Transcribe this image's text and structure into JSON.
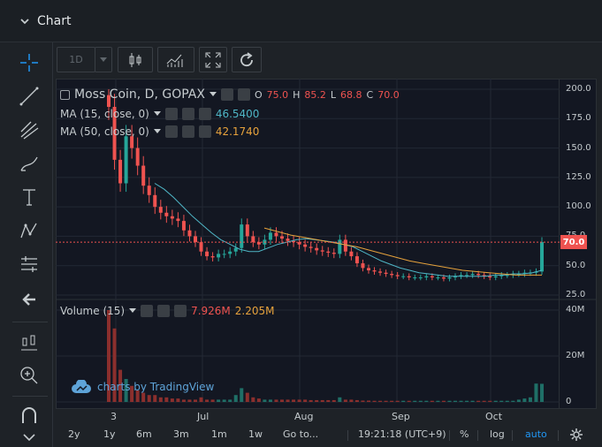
{
  "panel": {
    "title": "Chart"
  },
  "toolbar": {
    "interval": "1D"
  },
  "legend": {
    "symbol": "Moss Coin, D, GOPAX",
    "ohlc": [
      {
        "k": "O",
        "v": "75.0"
      },
      {
        "k": "H",
        "v": "85.2"
      },
      {
        "k": "L",
        "v": "68.8"
      },
      {
        "k": "C",
        "v": "70.0"
      }
    ],
    "ma15": {
      "label": "MA (15, close, 0)",
      "value": "46.5400",
      "color": "#4fb6c6"
    },
    "ma50": {
      "label": "MA (50, close, 0)",
      "value": "42.1740",
      "color": "#e6a23c"
    },
    "volume": {
      "label": "Volume (15)",
      "value1": "7.926M",
      "value2": "2.205M"
    }
  },
  "last_price": "70.0",
  "watermark": "charts by TradingView",
  "footer": {
    "ranges": [
      "2y",
      "1y",
      "6m",
      "3m",
      "1m",
      "1w",
      "Go to..."
    ],
    "time": "19:21:18 (UTC+9)",
    "percent": "%",
    "log": "log",
    "auto": "auto"
  },
  "colors": {
    "up": "#26a69a",
    "down": "#ef5350",
    "ma15": "#4fb6c6",
    "ma50": "#e6a23c",
    "accent": "#2196f3"
  },
  "chart_data": {
    "type": "candlestick",
    "title": "Moss Coin, D, GOPAX",
    "price_axis": {
      "ticks": [
        "200.0",
        "175.0",
        "150.0",
        "125.0",
        "100.0",
        "75.0",
        "50.0",
        "25.0"
      ],
      "ylim": [
        25,
        200
      ]
    },
    "volume_axis": {
      "ticks": [
        "40M",
        "20M",
        "0"
      ],
      "ylim": [
        0,
        40
      ]
    },
    "time_axis": {
      "ticks": [
        "3",
        "Jul",
        "Aug",
        "Sep",
        "Oct"
      ]
    },
    "close_series": [
      185,
      140,
      120,
      160,
      150,
      135,
      118,
      110,
      100,
      95,
      92,
      90,
      88,
      80,
      75,
      70,
      62,
      58,
      57,
      60,
      60,
      62,
      65,
      85,
      75,
      70,
      68,
      72,
      78,
      75,
      73,
      71,
      70,
      68,
      66,
      65,
      63,
      62,
      61,
      60,
      72,
      62,
      58,
      52,
      48,
      46,
      45,
      44,
      43,
      42,
      41,
      41,
      40,
      40,
      40,
      41,
      40,
      40,
      39,
      40,
      41,
      42,
      42,
      43,
      42,
      41,
      40,
      41,
      42,
      42,
      43,
      43,
      44,
      44,
      45,
      70
    ],
    "ma15_series": [
      120,
      115,
      108,
      100,
      92,
      85,
      78,
      72,
      68,
      64,
      62,
      62,
      65,
      68,
      70,
      72,
      73,
      72,
      71,
      70,
      68,
      66,
      62,
      58,
      54,
      51,
      48,
      46,
      44,
      43,
      42,
      41,
      41,
      41,
      41,
      41,
      42,
      42,
      43,
      43,
      44,
      46
    ],
    "ma50_series": [
      82,
      79,
      76,
      74,
      72,
      70,
      68,
      66,
      63,
      60,
      57,
      54,
      52,
      50,
      48,
      46,
      45,
      44,
      43,
      42,
      42,
      42
    ],
    "volume_series": [
      40,
      32,
      14,
      10,
      7,
      5,
      4,
      3,
      3,
      2,
      2,
      1.5,
      1.5,
      1,
      1,
      1,
      2,
      1,
      1,
      1,
      1,
      1,
      3,
      6,
      4,
      2,
      1.5,
      1,
      1,
      1,
      1,
      1,
      1,
      1,
      1,
      0.8,
      0.8,
      0.8,
      0.8,
      0.8,
      2,
      1,
      1,
      0.8,
      0.6,
      0.6,
      0.5,
      0.5,
      0.5,
      0.5,
      0.5,
      0.5,
      0.5,
      0.5,
      0.5,
      0.5,
      0.5,
      0.5,
      0.5,
      0.5,
      0.5,
      0.5,
      0.5,
      0.5,
      0.5,
      0.5,
      0.5,
      0.5,
      0.5,
      0.5,
      0.5,
      1,
      1.5,
      2,
      8,
      7.9
    ]
  }
}
